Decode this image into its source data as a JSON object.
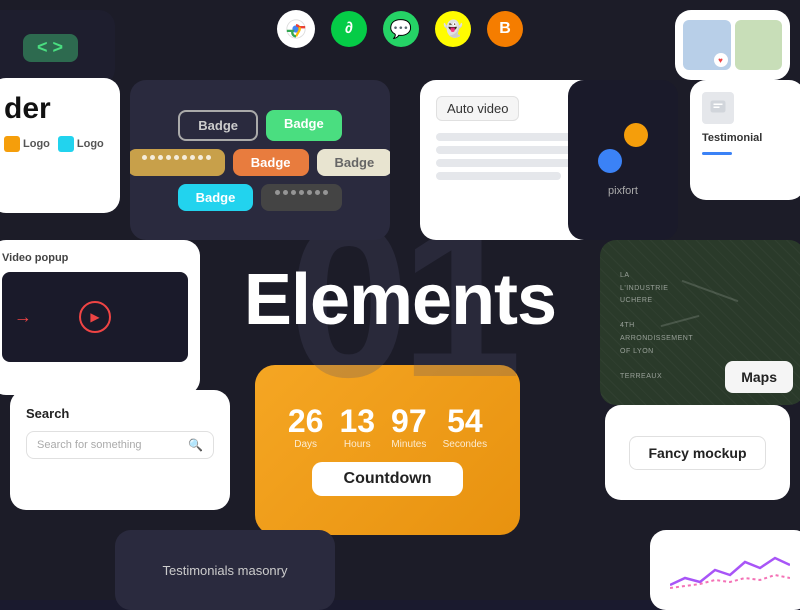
{
  "background_color": "#1c1c28",
  "center": {
    "title": "Elements",
    "bg_number": "01"
  },
  "social_icons": [
    {
      "name": "chrome-icon",
      "symbol": "◎",
      "bg": "#fff",
      "color": "#555"
    },
    {
      "name": "deviantart-icon",
      "symbol": "∂",
      "bg": "#05cc47",
      "color": "#fff"
    },
    {
      "name": "whatsapp-icon",
      "symbol": "✆",
      "bg": "#25d366",
      "color": "#fff"
    },
    {
      "name": "snapchat-icon",
      "symbol": "◉",
      "bg": "#fffc00",
      "color": "#000"
    },
    {
      "name": "blogger-icon",
      "symbol": "B",
      "bg": "#f57d00",
      "color": "#fff"
    }
  ],
  "badges_card": {
    "rows": [
      [
        {
          "label": "Badge",
          "style": "outline"
        },
        {
          "label": "Badge",
          "style": "green"
        }
      ],
      [
        {
          "label": "•••••••••",
          "style": "dots-amber"
        },
        {
          "label": "Badge",
          "style": "orange"
        },
        {
          "label": "Badge",
          "style": "gray"
        }
      ],
      [
        {
          "label": "Badge",
          "style": "cyan"
        },
        {
          "label": "•••••••",
          "style": "dots-dark"
        }
      ]
    ]
  },
  "auto_video": {
    "label": "Auto video",
    "lines": [
      60,
      80,
      70,
      90,
      50
    ]
  },
  "pixfort": {
    "text": "pixfort"
  },
  "testimonial": {
    "label": "Testimonial"
  },
  "video_popup": {
    "label": "Video popup"
  },
  "maps": {
    "label": "Maps",
    "overlay_text": [
      "La",
      "L'Industrie",
      "Uchere",
      "",
      "4th",
      "Arrondissement",
      "of Lyon",
      "",
      "Terreaux"
    ]
  },
  "search": {
    "label": "Search",
    "placeholder": "Search for something"
  },
  "countdown": {
    "days_num": "26",
    "days_label": "Days",
    "hours_num": "13",
    "hours_label": "Hours",
    "minutes_num": "97",
    "minutes_label": "Minutes",
    "seconds_num": "54",
    "seconds_label": "Secondes",
    "button_label": "Countdown"
  },
  "fancy_mockup": {
    "label": "Fancy mockup"
  },
  "testimonials_masonry": {
    "label": "Testimonials masonry"
  },
  "builder": {
    "text": "der",
    "logos": [
      {
        "text": "Logo",
        "color": "#f59e0b"
      },
      {
        "text": "Logo",
        "color": "#22d3ee"
      }
    ]
  }
}
